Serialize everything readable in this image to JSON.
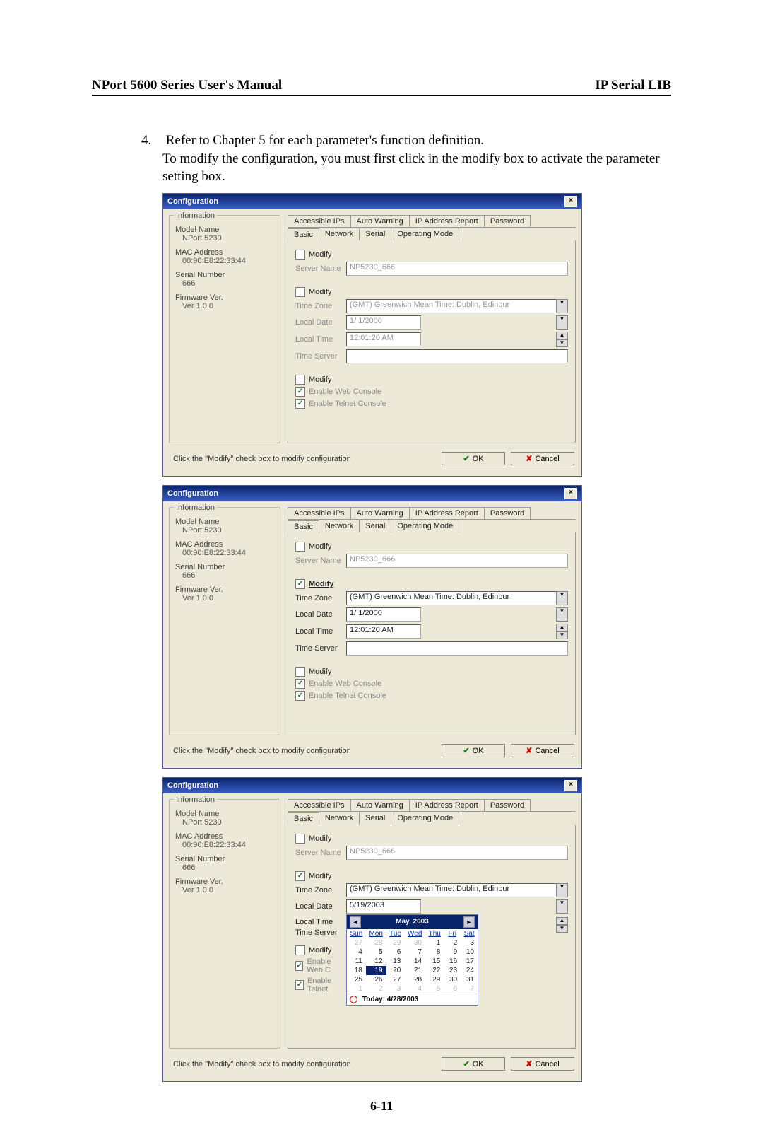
{
  "header": {
    "left": "NPort 5600 Series User's Manual",
    "right": "IP Serial LIB"
  },
  "step": {
    "num": "4.",
    "line1": "Refer to Chapter 5 for each parameter's function definition.",
    "line2": "To modify the configuration, you must first click in the modify box to activate the parameter setting box."
  },
  "dialog": {
    "title": "Configuration",
    "tabs_row1": [
      "Accessible IPs",
      "Auto Warning",
      "IP Address Report",
      "Password"
    ],
    "tabs_row2": [
      "Basic",
      "Network",
      "Serial",
      "Operating Mode"
    ],
    "info": {
      "group": "Information",
      "model_lbl": "Model Name",
      "model_val": "NPort 5230",
      "mac_lbl": "MAC Address",
      "mac_val": "00:90:E8:22:33:44",
      "sn_lbl": "Serial Number",
      "sn_val": "666",
      "fw_lbl": "Firmware Ver.",
      "fw_val": "Ver 1.0.0"
    },
    "modify": "Modify",
    "server_name_lbl": "Server Name",
    "server_name_val": "NP5230_666",
    "tz_lbl": "Time Zone",
    "tz_val": "(GMT) Greenwich Mean Time: Dublin, Edinbur",
    "date_lbl": "Local Date",
    "date_val": "1/ 1/2000",
    "date_val3": "5/19/2003",
    "time_lbl": "Local Time",
    "time_val": "12:01:20 AM",
    "tserver_lbl": "Time Server",
    "tserver_val": "",
    "enable_web": "Enable Web Console",
    "enable_telnet": "Enable Telnet Console",
    "enable_web_short": "Enable Web C",
    "enable_telnet_short": "Enable Telnet",
    "hint": "Click the \"Modify\" check box to modify configuration",
    "ok": "OK",
    "cancel": "Cancel"
  },
  "calendar": {
    "title": "May, 2003",
    "dow": [
      "Sun",
      "Mon",
      "Tue",
      "Wed",
      "Thu",
      "Fri",
      "Sat"
    ],
    "rows": [
      [
        "27",
        "28",
        "29",
        "30",
        "1",
        "2",
        "3"
      ],
      [
        "4",
        "5",
        "6",
        "7",
        "8",
        "9",
        "10"
      ],
      [
        "11",
        "12",
        "13",
        "14",
        "15",
        "16",
        "17"
      ],
      [
        "18",
        "19",
        "20",
        "21",
        "22",
        "23",
        "24"
      ],
      [
        "25",
        "26",
        "27",
        "28",
        "29",
        "30",
        "31"
      ],
      [
        "1",
        "2",
        "3",
        "4",
        "5",
        "6",
        "7"
      ]
    ],
    "selected": "19",
    "today": "Today: 4/28/2003"
  },
  "page_number": "6-11"
}
